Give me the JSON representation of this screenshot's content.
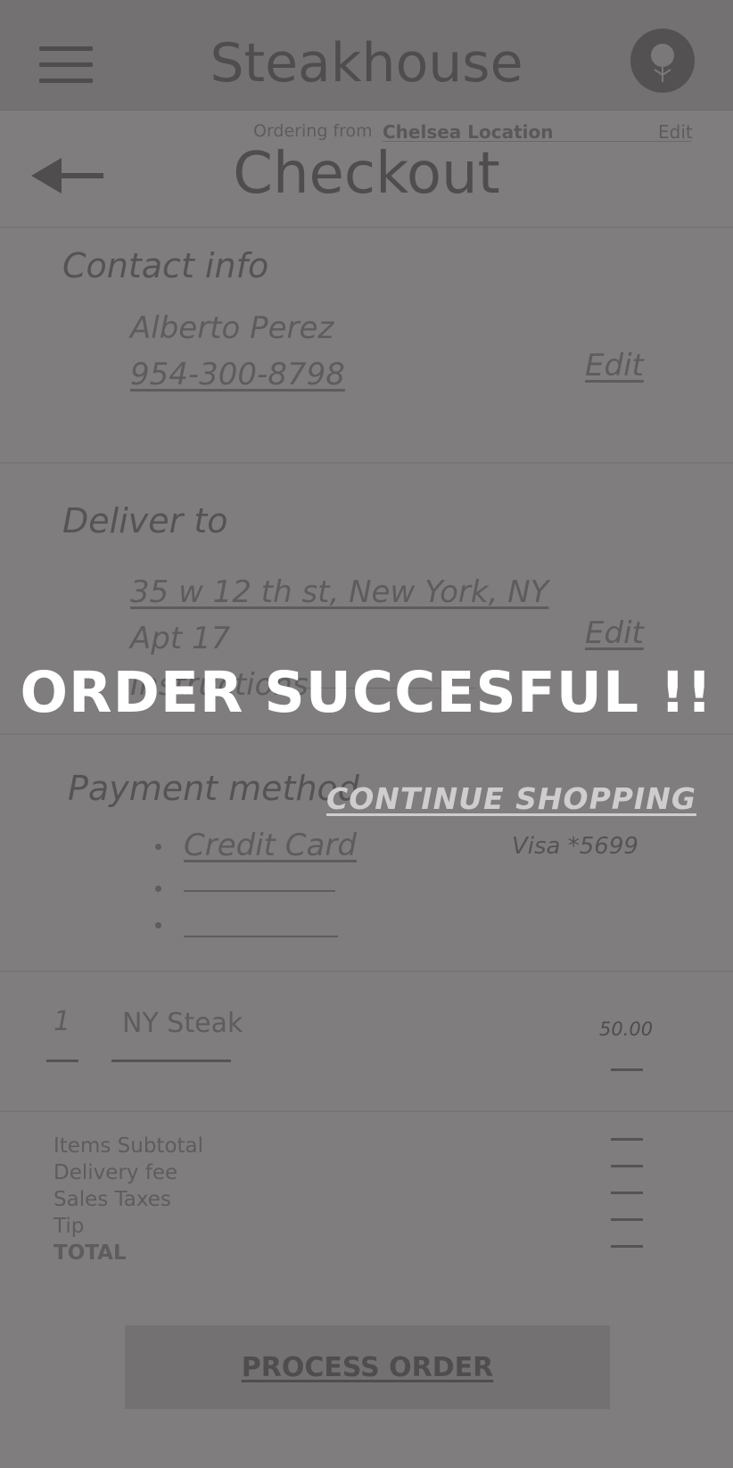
{
  "header": {
    "brand": "Steakhouse",
    "menu_icon": "hamburger-menu-icon",
    "profile_icon": "profile-avatar-icon"
  },
  "ordering": {
    "prefix": "Ordering from",
    "location": "Chelsea Location",
    "edit_label": "Edit"
  },
  "page": {
    "back_icon": "back-arrow-icon",
    "title": "Checkout"
  },
  "contact": {
    "title": "Contact info",
    "name": "Alberto Perez",
    "phone": "954-300-8798",
    "edit_label": "Edit"
  },
  "delivery": {
    "title": "Deliver to",
    "address": "35 w 12 th st, New York, NY",
    "apt": "Apt 17",
    "instructions": "Instructions",
    "edit_label": "Edit"
  },
  "payment": {
    "title": "Payment method",
    "options": [
      "Credit Card",
      "",
      ""
    ],
    "card": "Visa *5699"
  },
  "order_item": {
    "quantity": "1",
    "name": "NY Steak",
    "price": "50.00"
  },
  "summary": {
    "labels": [
      "Items Subtotal",
      "Delivery fee",
      "Sales Taxes",
      "Tip"
    ],
    "total_label": "TOTAL"
  },
  "process_button": "PROCESS ORDER",
  "overlay": {
    "message": "ORDER SUCCESFUL !!",
    "continue_label": "CONTINUE SHOPPING"
  },
  "colors": {
    "overlay_dim": "#7f7d7e",
    "header_bg": "#737172",
    "message_text": "#ffffff"
  }
}
